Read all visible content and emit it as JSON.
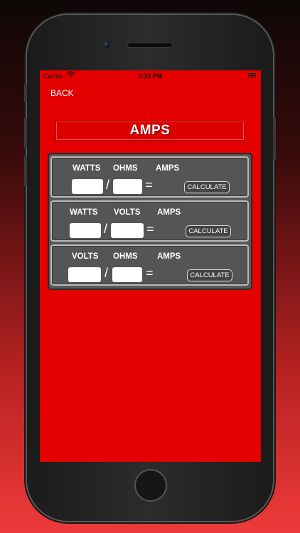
{
  "status_bar": {
    "carrier": "Carrier",
    "time": "2:10 PM"
  },
  "nav": {
    "back_label": "BACK"
  },
  "title": "AMPS",
  "colors": {
    "screen_background": "#e40000",
    "panel": "#555555",
    "field": "#ffffff"
  },
  "rows": [
    {
      "labels": [
        "WATTS",
        "OHMS",
        "AMPS"
      ],
      "operator": "/",
      "equals": "=",
      "button": "CALCULATE"
    },
    {
      "labels": [
        "WATTS",
        "VOLTS",
        "AMPS"
      ],
      "operator": "/",
      "equals": "=",
      "button": "CALCULATE"
    },
    {
      "labels": [
        "VOLTS",
        "OHMS",
        "AMPS"
      ],
      "operator": "/",
      "equals": "=",
      "button": "CALCULATE"
    }
  ]
}
